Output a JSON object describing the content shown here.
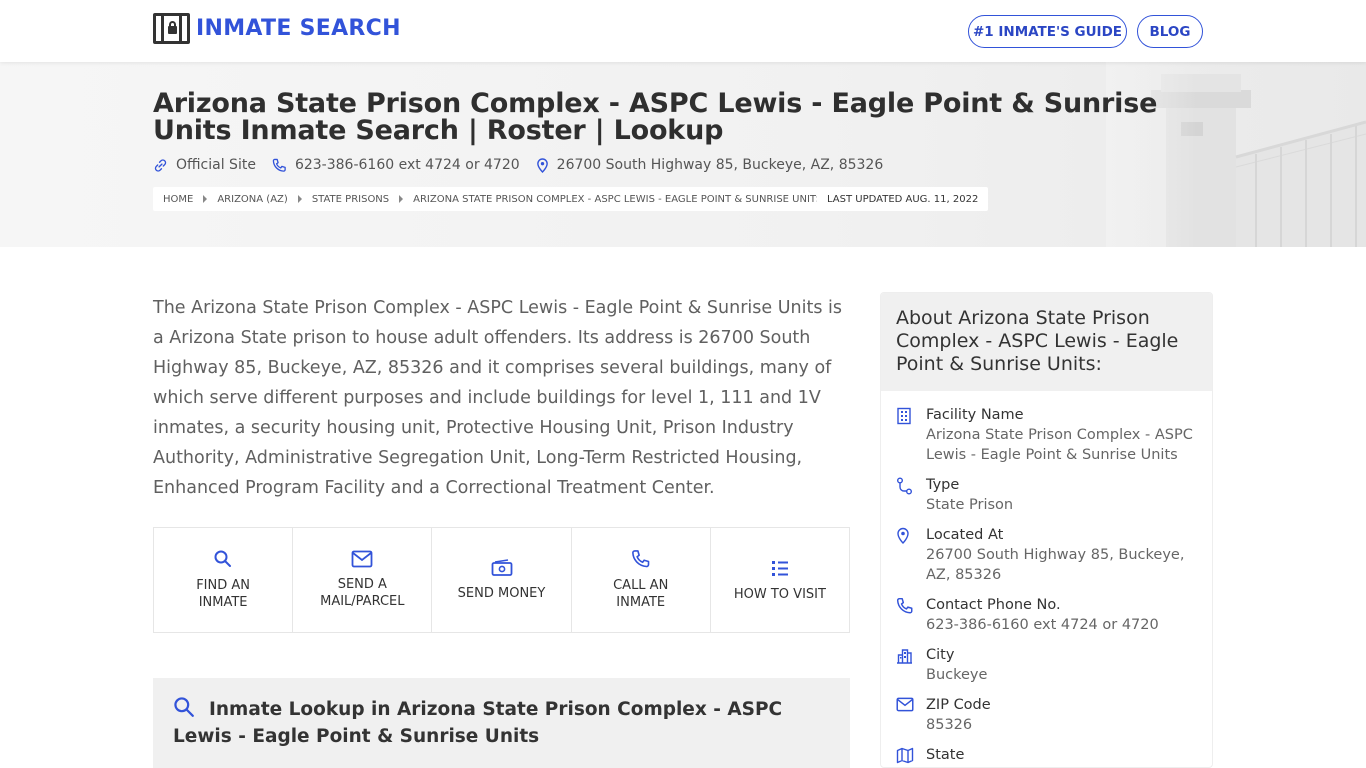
{
  "header": {
    "logo_text": "INMATE SEARCH",
    "nav": [
      {
        "label": "#1 INMATE'S GUIDE"
      },
      {
        "label": "BLOG"
      }
    ]
  },
  "hero": {
    "title": "Arizona State Prison Complex - ASPC Lewis - Eagle Point & Sunrise Units Inmate Search | Roster | Lookup",
    "official_site": "Official Site",
    "phone": "623-386-6160 ext 4724 or 4720",
    "address": "26700 South Highway 85, Buckeye, AZ, 85326",
    "breadcrumb": [
      "HOME",
      "ARIZONA (AZ)",
      "STATE PRISONS",
      "ARIZONA STATE PRISON COMPLEX - ASPC LEWIS - EAGLE POINT & SUNRISE UNITS"
    ],
    "last_updated": "LAST UPDATED AUG. 11, 2022"
  },
  "intro": "The Arizona State Prison Complex - ASPC Lewis - Eagle Point & Sunrise Units is a Arizona State prison to house adult offenders. Its address is 26700 South Highway 85, Buckeye, AZ, 85326 and it comprises several buildings, many of which serve different purposes and include buildings for level 1, 111 and 1V inmates, a security housing unit, Protective Housing Unit, Prison Industry Authority, Administrative Segregation Unit, Long-Term Restricted Housing, Enhanced Program Facility and a Correctional Treatment Center.",
  "actions": [
    {
      "line1": "FIND AN",
      "line2": "INMATE",
      "icon": "search-icon"
    },
    {
      "line1": "SEND A",
      "line2": "MAIL/PARCEL",
      "icon": "mail-icon"
    },
    {
      "line1": "SEND MONEY",
      "line2": "",
      "icon": "money-icon"
    },
    {
      "line1": "CALL AN",
      "line2": "INMATE",
      "icon": "phone-icon"
    },
    {
      "line1": "HOW TO VISIT",
      "line2": "",
      "icon": "list-icon"
    }
  ],
  "lookup_heading": "Inmate Lookup in Arizona State Prison Complex - ASPC Lewis - Eagle Point & Sunrise Units",
  "sidebar": {
    "title": "About Arizona State Prison Complex - ASPC Lewis - Eagle Point & Sunrise Units:",
    "items": [
      {
        "label": "Facility Name",
        "value": "Arizona State Prison Complex - ASPC Lewis - Eagle Point & Sunrise Units",
        "icon": "building-icon"
      },
      {
        "label": "Type",
        "value": "State Prison",
        "icon": "route-icon"
      },
      {
        "label": "Located At",
        "value": "26700 South Highway 85, Buckeye, AZ, 85326",
        "icon": "location-icon"
      },
      {
        "label": "Contact Phone No.",
        "value": "623-386-6160 ext 4724 or 4720",
        "icon": "phone-icon"
      },
      {
        "label": "City",
        "value": "Buckeye",
        "icon": "city-icon"
      },
      {
        "label": "ZIP Code",
        "value": "85326",
        "icon": "mail-icon"
      },
      {
        "label": "State",
        "value": "",
        "icon": "map-icon"
      }
    ]
  },
  "colors": {
    "accent": "#3253d9",
    "hero_bg": "#f3f3f3",
    "panel_bg": "#f0f0f0"
  }
}
